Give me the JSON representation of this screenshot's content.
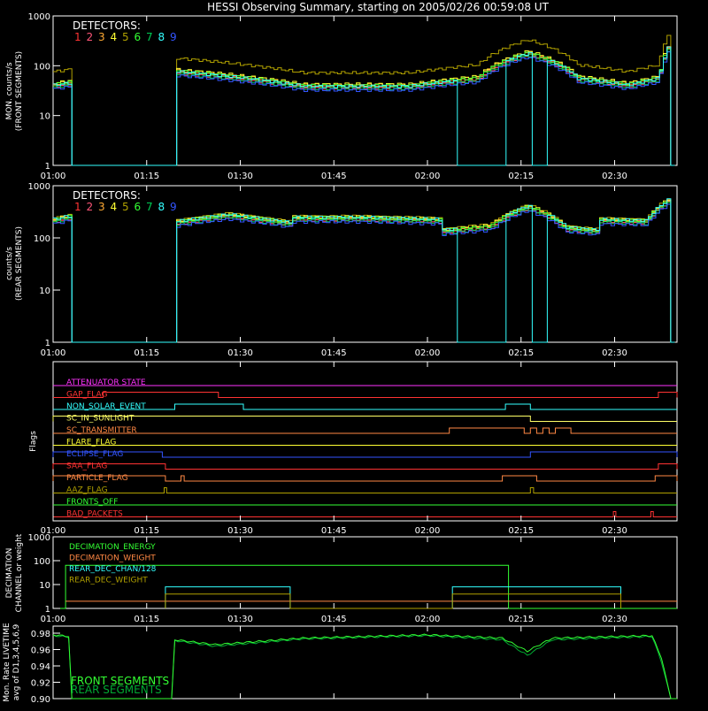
{
  "title": "HESSI Observing Summary, starting on 2005/02/26 00:59:08 UT",
  "colors": {
    "d1": "#ff3333",
    "d2": "#ff5577",
    "d3": "#ffaa33",
    "d4": "#ffff33",
    "d5": "#b0a000",
    "d6": "#33ff33",
    "d7": "#00cc55",
    "d8": "#33ffff",
    "d9": "#3355ff"
  },
  "time_ticks": [
    "01:00",
    "01:15",
    "01:30",
    "01:45",
    "02:00",
    "02:15",
    "02:30"
  ],
  "chart_data": [
    {
      "type": "line",
      "name": "front",
      "ylabel_lines": [
        "MON. counts/s",
        "(FRONT SEGMENTS)"
      ],
      "legend_title": "DETECTORS:",
      "legend_numbers": [
        "1",
        "2",
        "3",
        "4",
        "5",
        "6",
        "7",
        "8",
        "9"
      ],
      "y_scale": "log",
      "ylim": [
        1,
        1000
      ],
      "yticks": [
        "1000",
        "100",
        "10",
        "1"
      ],
      "x_unit": "minutes after 01:00",
      "series_note_gaps": [
        [
          2.8,
          19.5
        ]
      ],
      "profile_points": [
        [
          0,
          40
        ],
        [
          2.8,
          45
        ],
        [
          19.5,
          75
        ],
        [
          28,
          60
        ],
        [
          40,
          38
        ],
        [
          57,
          38
        ],
        [
          68,
          55
        ],
        [
          76,
          175
        ],
        [
          84,
          55
        ],
        [
          92,
          40
        ],
        [
          97,
          55
        ],
        [
          98.5,
          230
        ]
      ],
      "series_offsets": {
        "d1": 1.0,
        "d2": 0.95,
        "d3": 1.08,
        "d4": 1.12,
        "d5": 1.9,
        "d6": 1.05,
        "d7": 0.92,
        "d8": 1.02,
        "d9": 0.85
      },
      "d8_dropouts": [
        [
          64.8,
          72.5
        ],
        [
          76.6,
          78.8
        ]
      ]
    },
    {
      "type": "line",
      "name": "rear",
      "ylabel_lines": [
        "counts/s",
        "(REAR SEGMENTS)"
      ],
      "legend_title": "DETECTORS:",
      "legend_numbers": [
        "1",
        "2",
        "3",
        "4",
        "5",
        "6",
        "7",
        "8",
        "9"
      ],
      "y_scale": "log",
      "ylim": [
        1,
        1000
      ],
      "yticks": [
        "1000",
        "100",
        "10",
        "1"
      ],
      "x_unit": "minutes after 01:00",
      "series_note_gaps": [
        [
          2.8,
          19.5
        ]
      ],
      "profile_points": [
        [
          0,
          210
        ],
        [
          2.8,
          250
        ],
        [
          19.5,
          190
        ],
        [
          28,
          260
        ],
        [
          38,
          180
        ],
        [
          38.1,
          230
        ],
        [
          50,
          230
        ],
        [
          62,
          210
        ],
        [
          62.1,
          130
        ],
        [
          70,
          160
        ],
        [
          76,
          380
        ],
        [
          82,
          150
        ],
        [
          87,
          130
        ],
        [
          87.1,
          210
        ],
        [
          95,
          200
        ],
        [
          98.5,
          500
        ]
      ],
      "series_offsets": {
        "d1": 1.0,
        "d2": 0.96,
        "d3": 1.06,
        "d4": 1.1,
        "d5": 1.12,
        "d6": 1.05,
        "d7": 0.94,
        "d8": 1.08,
        "d9": 0.88
      },
      "d8_dropouts": [
        [
          64.8,
          72.5
        ],
        [
          76.6,
          78.8
        ]
      ]
    },
    {
      "type": "table",
      "name": "flags",
      "ylabel": "Flags",
      "flags": [
        {
          "label": "ATTENUATOR STATE",
          "color": "#ff33ff",
          "on": []
        },
        {
          "label": "GAP_FLAG",
          "color": "#ff3333",
          "on": [
            [
              8,
              26.5
            ],
            [
              97,
              100
            ]
          ]
        },
        {
          "label": "NON_SOLAR_EVENT",
          "color": "#33ffff",
          "on": [
            [
              19.5,
              30.5
            ],
            [
              72.5,
              76.5
            ]
          ]
        },
        {
          "label": "SC_IN_SUNLIGHT",
          "color": "#ffff66",
          "on": [
            [
              0,
              76.5
            ]
          ]
        },
        {
          "label": "SC_TRANSMITTER",
          "color": "#ff8844",
          "on": [
            [
              63.5,
              75.5
            ],
            [
              76.5,
              77.5
            ],
            [
              78.5,
              79.5
            ],
            [
              80.5,
              83
            ]
          ]
        },
        {
          "label": "FLARE_FLAG",
          "color": "#ffff33",
          "on": []
        },
        {
          "label": "ECLIPSE_FLAG",
          "color": "#3355ff",
          "on": [
            [
              0,
              17.5
            ],
            [
              76.5,
              100
            ]
          ]
        },
        {
          "label": "SAA_FLAG",
          "color": "#ff3333",
          "on": [
            [
              0,
              18
            ],
            [
              97,
              100
            ]
          ]
        },
        {
          "label": "PARTICLE_FLAG",
          "color": "#ff8844",
          "on": [
            [
              0,
              18
            ],
            [
              20.5,
              21
            ],
            [
              72,
              77.5
            ],
            [
              96.5,
              100
            ]
          ]
        },
        {
          "label": "AAZ_FLAG",
          "color": "#b0a000",
          "on": [
            [
              17.8,
              18.2
            ],
            [
              76.5,
              77
            ]
          ]
        },
        {
          "label": "FRONTS_OFF",
          "color": "#33ff33",
          "on": []
        },
        {
          "label": "BAD_PACKETS",
          "color": "#ff3333",
          "on": [
            [
              89.8,
              90.2
            ],
            [
              95.8,
              96.2
            ]
          ]
        }
      ]
    },
    {
      "type": "line",
      "name": "decimation",
      "ylabel_lines": [
        "DECIMATION",
        "CHANNEL or weight"
      ],
      "y_scale": "log",
      "ylim": [
        1,
        1000
      ],
      "yticks": [
        "1000",
        "100",
        "10",
        "1"
      ],
      "legend": [
        {
          "label": "DECIMATION_ENERGY",
          "color": "#33ff33"
        },
        {
          "label": "DECIMATION_WEIGHT",
          "color": "#ff8844"
        },
        {
          "label": "REAR_DEC_CHAN/128",
          "color": "#33ffff"
        },
        {
          "label": "REAR_DEC_WEIGHT",
          "color": "#b0a000"
        }
      ],
      "energy": [
        [
          0,
          1
        ],
        [
          2,
          1
        ],
        [
          2,
          64
        ],
        [
          73,
          64
        ],
        [
          73,
          1
        ],
        [
          100,
          1
        ]
      ],
      "weight": [
        [
          2,
          2
        ],
        [
          100,
          2
        ]
      ],
      "rear_chan": [
        [
          18,
          1
        ],
        [
          18,
          8
        ],
        [
          38,
          8
        ],
        [
          38,
          1
        ],
        [
          64,
          1
        ],
        [
          64,
          8
        ],
        [
          91,
          8
        ],
        [
          91,
          1
        ]
      ],
      "rear_weight": [
        [
          18,
          1
        ],
        [
          18,
          4
        ],
        [
          38,
          4
        ],
        [
          38,
          1
        ],
        [
          64,
          1
        ],
        [
          64,
          4
        ],
        [
          91,
          4
        ],
        [
          91,
          1
        ]
      ]
    },
    {
      "type": "line",
      "name": "livetime",
      "ylabel_lines": [
        "Mon. Rate LIVETIME",
        "avg of D1,3,4,5,6,9"
      ],
      "ylim": [
        0.9,
        0.98
      ],
      "yticks": [
        "0.98",
        "0.96",
        "0.94",
        "0.92",
        "0.90"
      ],
      "legend": [
        {
          "label": "FRONT SEGMENTS",
          "color": "#33ff33"
        },
        {
          "label": "REAR SEGMENTS",
          "color": "#00aa33"
        }
      ],
      "front": [
        [
          0,
          0.978
        ],
        [
          2.8,
          0.976
        ],
        [
          19.5,
          0.972
        ],
        [
          26,
          0.966
        ],
        [
          40,
          0.974
        ],
        [
          60,
          0.978
        ],
        [
          72,
          0.974
        ],
        [
          76,
          0.958
        ],
        [
          80,
          0.974
        ],
        [
          96,
          0.977
        ],
        [
          97.5,
          0.95
        ],
        [
          99,
          0.9
        ]
      ],
      "rear": [
        [
          0,
          0.977
        ],
        [
          2.8,
          0.975
        ],
        [
          19.5,
          0.971
        ],
        [
          26,
          0.964
        ],
        [
          40,
          0.973
        ],
        [
          60,
          0.977
        ],
        [
          72,
          0.972
        ],
        [
          76,
          0.953
        ],
        [
          80,
          0.972
        ],
        [
          96,
          0.976
        ],
        [
          97.5,
          0.945
        ],
        [
          99,
          0.9
        ]
      ]
    }
  ]
}
